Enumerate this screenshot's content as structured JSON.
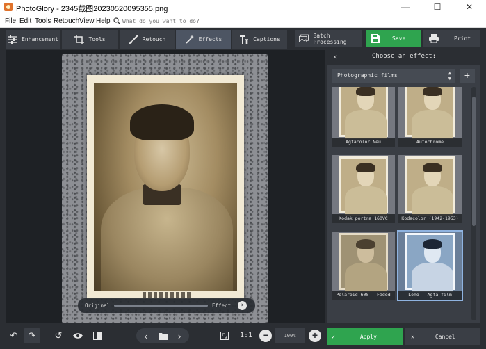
{
  "window": {
    "title": "PhotoGlory - 2345截图20230520095355.png",
    "minimize_glyph": "—",
    "maximize_glyph": "☐",
    "close_glyph": "✕"
  },
  "menu": {
    "items": [
      "File",
      "Edit",
      "Tools",
      "Retouch",
      "View",
      "Help"
    ],
    "search_placeholder": "What do you want to do?"
  },
  "toolbar": {
    "tabs": [
      {
        "label": "Enhancement",
        "icon": "sliders-icon"
      },
      {
        "label": "Tools",
        "icon": "crop-icon"
      },
      {
        "label": "Retouch",
        "icon": "brush-icon"
      },
      {
        "label": "Effects",
        "icon": "magic-wand-icon",
        "active": true
      },
      {
        "label": "Captions",
        "icon": "text-icon"
      }
    ],
    "batch_label": "Batch Processing",
    "save_label": "Save",
    "print_label": "Print"
  },
  "compare": {
    "original_label": "Original",
    "effect_label": "Effect",
    "position": 1.0
  },
  "panel": {
    "title": "Choose an effect:",
    "category": "Photographic films",
    "effects": [
      {
        "name": "Agfacolor Neu",
        "tone": "warm"
      },
      {
        "name": "Autochrome",
        "tone": "warm"
      },
      {
        "name": "Kodak portra 160VC",
        "tone": "warm"
      },
      {
        "name": "Kodacolor (1942-1953)",
        "tone": "warm"
      },
      {
        "name": "Polaroid 600 - Faded",
        "tone": "faded"
      },
      {
        "name": "Lomo - Agfa film",
        "tone": "cool",
        "selected": true
      }
    ]
  },
  "bottom": {
    "zoom_value": "100%",
    "one_to_one": "1:1",
    "apply_label": "Apply",
    "cancel_label": "Cancel"
  },
  "colors": {
    "accent_green": "#2fa44f",
    "panel_bg": "#3a3e45",
    "app_bg": "#2b2e33",
    "selection_blue": "#8fb3e0"
  }
}
